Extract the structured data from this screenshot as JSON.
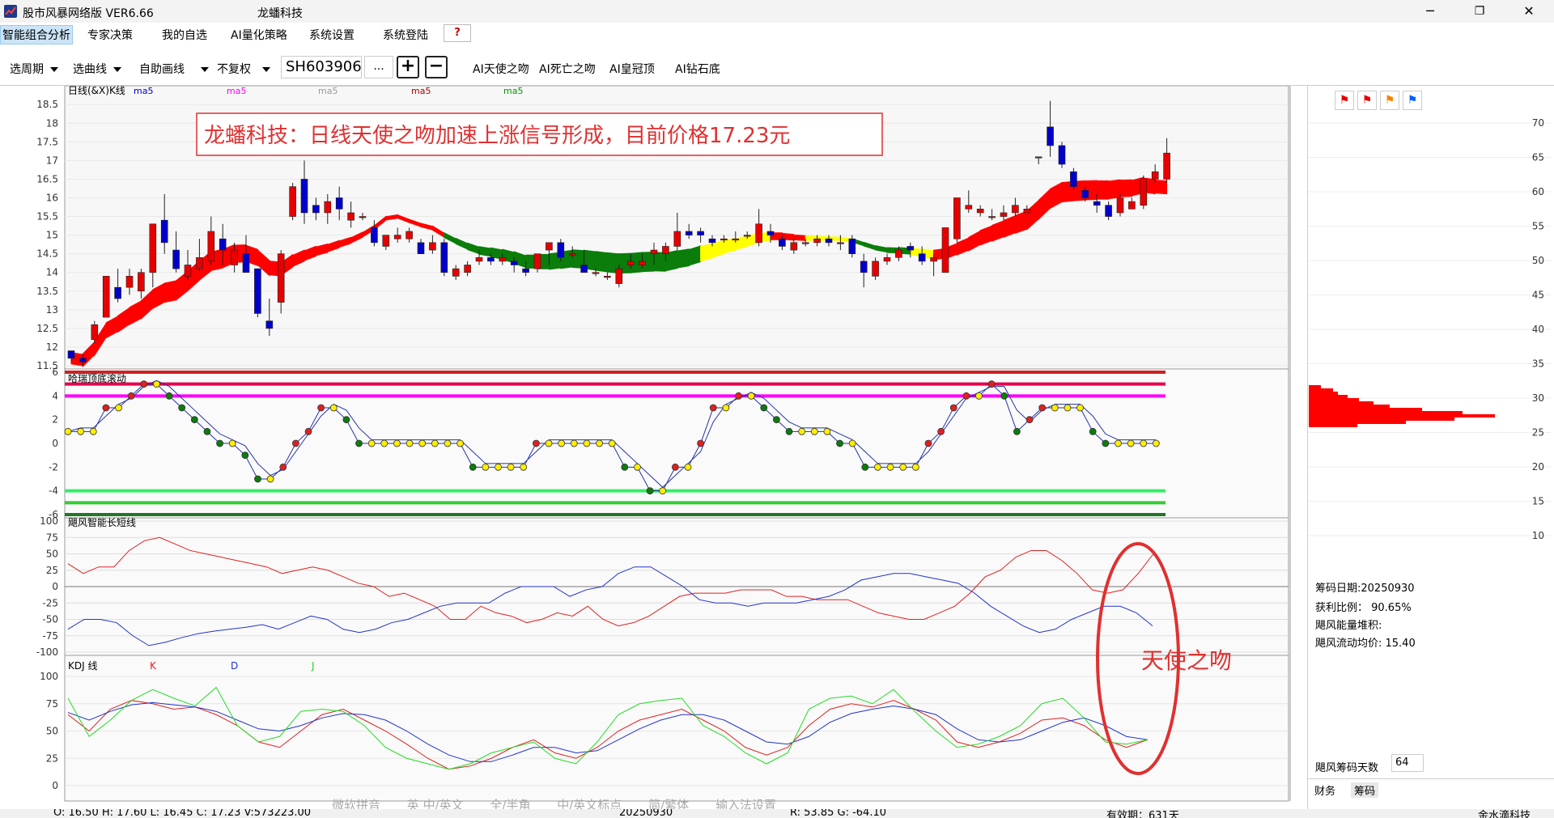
{
  "titlebar": {
    "app_title": "股市风暴网络版 VER6.66",
    "stock_title": "龙蟠科技",
    "minimize": "─",
    "maximize": "❐",
    "close": "✕"
  },
  "menu": {
    "items": [
      "智能组合分析",
      "专家决策",
      "我的自选",
      "AI量化策略",
      "系统设置",
      "系统登陆"
    ],
    "help": "?"
  },
  "toolbar": {
    "period": "选周期",
    "indicator": "选曲线",
    "draw": "自助画线",
    "adjust": "不复权",
    "code": "SH603906",
    "dots": "...",
    "plus": "+",
    "minus": "−",
    "ai_buttons": [
      "AI天使之吻",
      "AI死亡之吻",
      "AI皇冠顶",
      "AI钻石底"
    ]
  },
  "colors": {
    "up": "#e60000",
    "down": "#0000cc",
    "ribbon_red": "#ff0000",
    "ribbon_green": "#0a7d0a",
    "ribbon_yellow": "#ffff00",
    "annotation": "#e03030"
  },
  "main_chart": {
    "label": "日线(&X)K线",
    "ma_labels": [
      {
        "text": "ma5",
        "color": "#0000cc"
      },
      {
        "text": "ma5",
        "color": "#ff00ff"
      },
      {
        "text": "ma5",
        "color": "#999999"
      },
      {
        "text": "ma5",
        "color": "#aa0000"
      },
      {
        "text": "ma5",
        "color": "#009900"
      }
    ],
    "headline": "龙蟠科技：日线天使之吻加速上涨信号形成，目前价格17.23元",
    "y_ticks": [
      "18.5",
      "18",
      "17.5",
      "17",
      "16.5",
      "16",
      "15.5",
      "15",
      "14.5",
      "14",
      "13.5",
      "13",
      "12.5",
      "12",
      "11.5"
    ]
  },
  "osc_chart": {
    "label": "哈瑞顶底滚动",
    "y_ticks": [
      "6",
      "4",
      "2",
      "0",
      "-2",
      "-4",
      "-6"
    ]
  },
  "wind_chart": {
    "label": "飓风智能长短线",
    "y_ticks": [
      "100",
      "75",
      "50",
      "25",
      "0",
      "-25",
      "-50",
      "-75",
      "-100"
    ]
  },
  "kdj_chart": {
    "label": "KDJ 线",
    "k": "K",
    "d": "D",
    "j": "J",
    "y_ticks": [
      "100",
      "75",
      "50",
      "25",
      "0"
    ],
    "annotation": "天使之吻"
  },
  "right_panel": {
    "y_ticks": [
      "70",
      "65",
      "60",
      "55",
      "50",
      "45",
      "40",
      "35",
      "30",
      "25",
      "20",
      "15",
      "10"
    ],
    "chip_date": "筹码日期:20250930",
    "profit_ratio": "获利比例：  90.65%",
    "energy": "飓风能量堆积:",
    "avg_price": "飓风流动均价: 15.40",
    "days_label": "飓风筹码天数",
    "days_value": "64",
    "tabs": [
      "财务",
      "筹码"
    ]
  },
  "ime": [
    "微软拼音",
    "英 中/英文",
    "全/半角",
    "中/英文标点",
    "简/繁体",
    "输入法设置"
  ],
  "status": {
    "ohlc": "O: 16.50  H: 17.60  L: 16.45  C: 17.23  V:573223.00",
    "date": "20250930",
    "rg": "R: 53.85  G: -64.10",
    "valid": "有效期：631天",
    "company": "金水滴科技"
  },
  "chart_data": [
    {
      "type": "candlestick",
      "title": "日线(&X)K线",
      "ylim": [
        11.5,
        18.7
      ],
      "candles": [
        [
          11.9,
          11.7,
          11.9,
          11.6
        ],
        [
          11.7,
          11.6,
          11.8,
          11.5
        ],
        [
          12.2,
          12.6,
          12.7,
          12.1
        ],
        [
          12.8,
          13.9,
          13.9,
          12.8
        ],
        [
          13.6,
          13.3,
          14.1,
          13.2
        ],
        [
          13.6,
          13.9,
          14.1,
          13.4
        ],
        [
          13.5,
          14.0,
          14.1,
          13.3
        ],
        [
          14.0,
          15.3,
          15.3,
          13.6
        ],
        [
          15.4,
          14.8,
          16.1,
          14.5
        ],
        [
          14.6,
          14.1,
          15.1,
          14.0
        ],
        [
          13.9,
          14.2,
          14.6,
          13.8
        ],
        [
          14.1,
          14.4,
          14.9,
          14.0
        ],
        [
          14.3,
          15.1,
          15.5,
          14.2
        ],
        [
          14.9,
          14.6,
          15.3,
          14.2
        ],
        [
          14.2,
          14.6,
          14.8,
          14.0
        ],
        [
          14.5,
          14.0,
          15.0,
          14.0
        ],
        [
          14.1,
          12.9,
          14.1,
          12.8
        ],
        [
          12.7,
          12.5,
          13.3,
          12.3
        ],
        [
          13.2,
          14.5,
          14.6,
          12.9
        ],
        [
          15.5,
          16.3,
          16.4,
          15.4
        ],
        [
          16.5,
          15.6,
          17.0,
          15.3
        ],
        [
          15.8,
          15.6,
          16.0,
          15.4
        ],
        [
          15.6,
          15.9,
          16.1,
          15.3
        ],
        [
          16.0,
          15.7,
          16.3,
          15.4
        ],
        [
          15.4,
          15.6,
          15.9,
          15.2
        ],
        [
          15.5,
          15.5,
          15.6,
          15.4
        ],
        [
          15.2,
          14.8,
          15.4,
          14.7
        ],
        [
          14.7,
          15.0,
          15.0,
          14.6
        ],
        [
          14.9,
          15.0,
          15.2,
          14.8
        ],
        [
          14.9,
          15.1,
          15.2,
          14.8
        ],
        [
          14.8,
          14.5,
          14.9,
          14.5
        ],
        [
          14.6,
          14.8,
          15.0,
          14.5
        ],
        [
          14.8,
          14.0,
          14.9,
          13.9
        ],
        [
          13.9,
          14.1,
          14.2,
          13.8
        ],
        [
          14.0,
          14.2,
          14.3,
          13.9
        ],
        [
          14.3,
          14.4,
          14.6,
          14.2
        ],
        [
          14.4,
          14.3,
          14.5,
          14.2
        ],
        [
          14.3,
          14.4,
          14.5,
          14.2
        ],
        [
          14.3,
          14.2,
          14.4,
          14.0
        ],
        [
          14.1,
          14.0,
          14.3,
          13.9
        ],
        [
          14.1,
          14.5,
          14.5,
          14.0
        ],
        [
          14.6,
          14.8,
          14.8,
          14.2
        ],
        [
          14.8,
          14.4,
          14.9,
          14.3
        ],
        [
          14.5,
          14.5,
          14.7,
          14.4
        ],
        [
          14.2,
          14.0,
          14.6,
          14.0
        ],
        [
          14.0,
          14.0,
          14.1,
          13.9
        ],
        [
          13.9,
          13.9,
          14.0,
          13.8
        ],
        [
          13.7,
          14.1,
          14.2,
          13.6
        ],
        [
          14.2,
          14.3,
          14.5,
          14.1
        ],
        [
          14.2,
          14.3,
          14.5,
          14.1
        ],
        [
          14.5,
          14.6,
          14.8,
          14.2
        ],
        [
          14.5,
          14.7,
          14.8,
          14.3
        ],
        [
          14.7,
          15.1,
          15.6,
          14.6
        ],
        [
          15.1,
          15.0,
          15.3,
          14.9
        ],
        [
          15.1,
          15.0,
          15.2,
          14.8
        ],
        [
          14.9,
          14.8,
          15.0,
          14.7
        ],
        [
          14.9,
          14.9,
          15.0,
          14.8
        ],
        [
          14.9,
          14.9,
          15.1,
          14.8
        ],
        [
          15.0,
          15.0,
          15.1,
          14.9
        ],
        [
          14.8,
          15.3,
          15.7,
          14.7
        ],
        [
          15.1,
          15.0,
          15.3,
          14.8
        ],
        [
          14.9,
          14.7,
          15.0,
          14.6
        ],
        [
          14.6,
          14.8,
          14.9,
          14.5
        ],
        [
          14.8,
          14.8,
          14.9,
          14.7
        ],
        [
          14.8,
          14.9,
          15.0,
          14.7
        ],
        [
          14.9,
          14.8,
          15.0,
          14.7
        ],
        [
          14.8,
          14.8,
          15.0,
          14.6
        ],
        [
          14.9,
          14.5,
          15.0,
          14.4
        ],
        [
          14.3,
          14.0,
          14.5,
          13.6
        ],
        [
          13.9,
          14.3,
          14.4,
          13.8
        ],
        [
          14.3,
          14.4,
          14.5,
          14.2
        ],
        [
          14.4,
          14.6,
          14.7,
          14.3
        ],
        [
          14.7,
          14.6,
          14.8,
          14.4
        ],
        [
          14.5,
          14.3,
          14.7,
          14.2
        ],
        [
          14.3,
          14.4,
          14.5,
          13.9
        ],
        [
          14.0,
          15.2,
          15.2,
          14.0
        ],
        [
          14.9,
          16.0,
          16.0,
          14.8
        ],
        [
          15.7,
          15.8,
          16.2,
          15.6
        ],
        [
          15.6,
          15.7,
          15.8,
          15.5
        ],
        [
          15.5,
          15.5,
          15.7,
          15.4
        ],
        [
          15.5,
          15.6,
          15.8,
          15.4
        ],
        [
          15.6,
          15.8,
          16.0,
          15.5
        ],
        [
          15.6,
          15.7,
          15.8,
          15.6
        ],
        [
          17.1,
          17.1,
          17.1,
          16.9
        ],
        [
          17.9,
          17.4,
          18.6,
          17.1
        ],
        [
          17.4,
          16.9,
          17.5,
          16.8
        ],
        [
          16.7,
          16.3,
          16.8,
          16.2
        ],
        [
          16.2,
          16.0,
          16.3,
          15.9
        ],
        [
          15.9,
          15.8,
          16.1,
          15.6
        ],
        [
          15.8,
          15.5,
          15.9,
          15.4
        ],
        [
          15.6,
          16.0,
          16.1,
          15.5
        ],
        [
          15.7,
          15.9,
          16.0,
          15.7
        ],
        [
          15.8,
          16.5,
          16.6,
          15.7
        ],
        [
          16.5,
          16.7,
          16.9,
          16.4
        ],
        [
          16.5,
          17.2,
          17.6,
          16.4
        ]
      ]
    },
    {
      "type": "line",
      "title": "哈瑞顶底滚动",
      "ylim": [
        -6,
        6
      ],
      "levels": [
        6,
        5,
        4,
        -4,
        -5,
        -6
      ],
      "series": [
        {
          "name": "dots",
          "values": [
            1,
            1,
            1,
            3,
            3,
            4,
            5,
            5,
            4,
            3,
            2,
            1,
            0,
            0,
            -1,
            -3,
            -3,
            -2,
            0,
            1,
            3,
            3,
            2,
            0,
            0,
            0,
            0,
            0,
            0,
            0,
            0,
            0,
            -2,
            -2,
            -2,
            -2,
            -2,
            0,
            0,
            0,
            0,
            0,
            0,
            0,
            -2,
            -2,
            -4,
            -4,
            -2,
            -2,
            0,
            3,
            3,
            4,
            4,
            3,
            2,
            1,
            1,
            1,
            1,
            0,
            0,
            -2,
            -2,
            -2,
            -2,
            -2,
            0,
            1,
            3,
            4,
            4,
            5,
            4,
            1,
            2,
            3,
            3,
            3,
            3,
            1,
            0,
            0,
            0,
            0,
            0
          ]
        }
      ]
    },
    {
      "type": "line",
      "title": "飓风智能长短线",
      "ylim": [
        -100,
        100
      ],
      "series": [
        {
          "name": "red",
          "values": [
            35,
            20,
            30,
            30,
            55,
            70,
            75,
            65,
            55,
            50,
            45,
            40,
            35,
            30,
            20,
            25,
            30,
            25,
            15,
            5,
            0,
            -15,
            -10,
            -20,
            -30,
            -50,
            -50,
            -30,
            -40,
            -45,
            -55,
            -50,
            -40,
            -45,
            -30,
            -50,
            -60,
            -55,
            -45,
            -30,
            -15,
            -10,
            -10,
            -10,
            -5,
            -5,
            -5,
            -15,
            -15,
            -20,
            -20,
            -20,
            -30,
            -40,
            -45,
            -50,
            -50,
            -40,
            -30,
            -10,
            15,
            25,
            45,
            55,
            55,
            40,
            20,
            -5,
            -10,
            -5,
            20,
            50
          ]
        },
        {
          "name": "blue",
          "values": [
            -65,
            -50,
            -50,
            -55,
            -75,
            -90,
            -85,
            -78,
            -72,
            -68,
            -65,
            -62,
            -58,
            -65,
            -55,
            -45,
            -50,
            -65,
            -70,
            -65,
            -55,
            -50,
            -40,
            -30,
            -25,
            -25,
            -25,
            -10,
            0,
            0,
            0,
            -15,
            -5,
            0,
            20,
            30,
            30,
            15,
            0,
            -20,
            -25,
            -25,
            -30,
            -25,
            -25,
            -25,
            -20,
            -15,
            -5,
            10,
            15,
            20,
            20,
            15,
            10,
            5,
            -10,
            -30,
            -45,
            -60,
            -70,
            -65,
            -50,
            -40,
            -30,
            -30,
            -40,
            -60
          ]
        }
      ]
    },
    {
      "type": "line",
      "title": "KDJ 线",
      "ylim": [
        0,
        100
      ],
      "series": [
        {
          "name": "K",
          "values": [
            65,
            50,
            70,
            78,
            75,
            70,
            72,
            65,
            55,
            40,
            35,
            50,
            65,
            70,
            60,
            50,
            38,
            25,
            15,
            18,
            25,
            35,
            42,
            30,
            25,
            35,
            50,
            60,
            65,
            70,
            60,
            50,
            35,
            28,
            35,
            55,
            70,
            75,
            72,
            78,
            70,
            60,
            40,
            35,
            40,
            48,
            60,
            62,
            55,
            42,
            35,
            42
          ]
        },
        {
          "name": "D",
          "values": [
            67,
            60,
            68,
            74,
            76,
            74,
            72,
            68,
            60,
            52,
            50,
            55,
            62,
            66,
            65,
            60,
            50,
            38,
            28,
            22,
            22,
            28,
            35,
            35,
            30,
            32,
            42,
            52,
            60,
            65,
            65,
            60,
            50,
            40,
            38,
            45,
            58,
            66,
            70,
            73,
            70,
            65,
            52,
            42,
            40,
            42,
            50,
            58,
            62,
            55,
            45,
            42
          ]
        },
        {
          "name": "J",
          "values": [
            80,
            45,
            60,
            78,
            88,
            80,
            73,
            90,
            55,
            40,
            45,
            68,
            70,
            68,
            55,
            35,
            25,
            20,
            15,
            20,
            30,
            35,
            40,
            25,
            20,
            40,
            65,
            75,
            78,
            80,
            55,
            45,
            30,
            20,
            30,
            70,
            80,
            82,
            75,
            88,
            68,
            50,
            35,
            38,
            45,
            55,
            75,
            80,
            62,
            40,
            38,
            42
          ]
        }
      ]
    }
  ]
}
